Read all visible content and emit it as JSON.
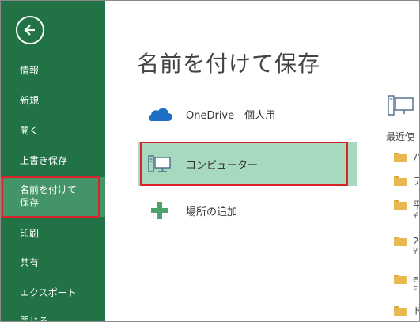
{
  "nav": {
    "items": [
      {
        "label": "情報"
      },
      {
        "label": "新規"
      },
      {
        "label": "開く"
      },
      {
        "label": "上書き保存"
      },
      {
        "label_line1": "名前を付けて",
        "label_line2": "保存"
      },
      {
        "label": "印刷"
      },
      {
        "label": "共有"
      },
      {
        "label": "エクスポート"
      },
      {
        "label": "閉じる"
      }
    ]
  },
  "main": {
    "title": "名前を付けて保存",
    "places": [
      {
        "label": "OneDrive - 個人用",
        "icon": "cloud-icon"
      },
      {
        "label": "コンピューター",
        "icon": "computer-icon",
        "selected": true
      },
      {
        "label": "場所の追加",
        "icon": "plus-icon"
      }
    ]
  },
  "right_pane": {
    "recent_header": "最近使",
    "folders": [
      {
        "name": "ハ",
        "sub": ""
      },
      {
        "name": "テ",
        "sub": ""
      },
      {
        "name": "平",
        "sub": "¥"
      },
      {
        "name": "2",
        "sub": "¥"
      },
      {
        "name": "e",
        "sub": "F"
      },
      {
        "name": "ド",
        "sub": ""
      }
    ]
  },
  "colors": {
    "sidebar": "#217346",
    "sidebar_selected": "#439467",
    "place_selected": "#a6d9bd",
    "highlight_outline": "#d9252a",
    "folder": "#e8b94f"
  }
}
